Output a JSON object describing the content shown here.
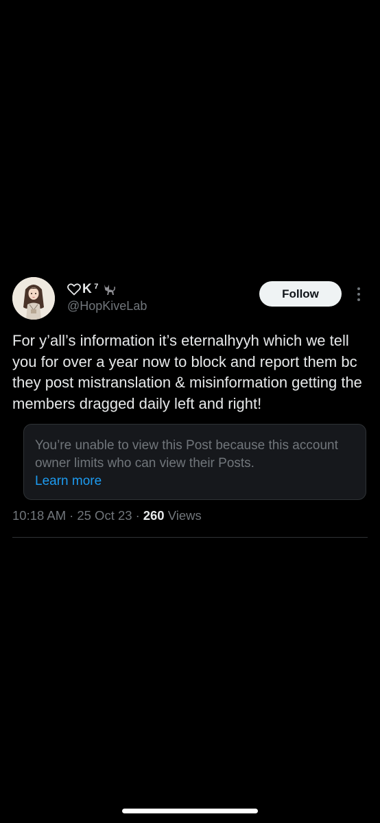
{
  "post": {
    "author": {
      "display_name_letter": "K",
      "display_name_superscript": "7",
      "handle": "@HopKiveLab",
      "name_icons": [
        "heart-outline-icon",
        "black-cat-icon"
      ]
    },
    "follow_label": "Follow",
    "text": "For y’all’s information it’s eternalhyyh which we tell you for over a year now to block and report them bc they post mistranslation & misinformation getting the members dragged daily left and right!",
    "restricted_notice": {
      "message": "You’re unable to view this Post because this account owner limits who can view their Posts.",
      "link_label": "Learn more"
    },
    "meta": {
      "time": "10:18 AM",
      "separator": "·",
      "date": "25 Oct 23",
      "views_count": "260",
      "views_label": "Views"
    }
  },
  "colors": {
    "background": "#000000",
    "primary_text": "#e7e9ea",
    "secondary_text": "#71767b",
    "link": "#1d9bf0",
    "follow_button_bg": "#eff3f4",
    "card_bg": "#16181c",
    "border": "#2f3336"
  }
}
